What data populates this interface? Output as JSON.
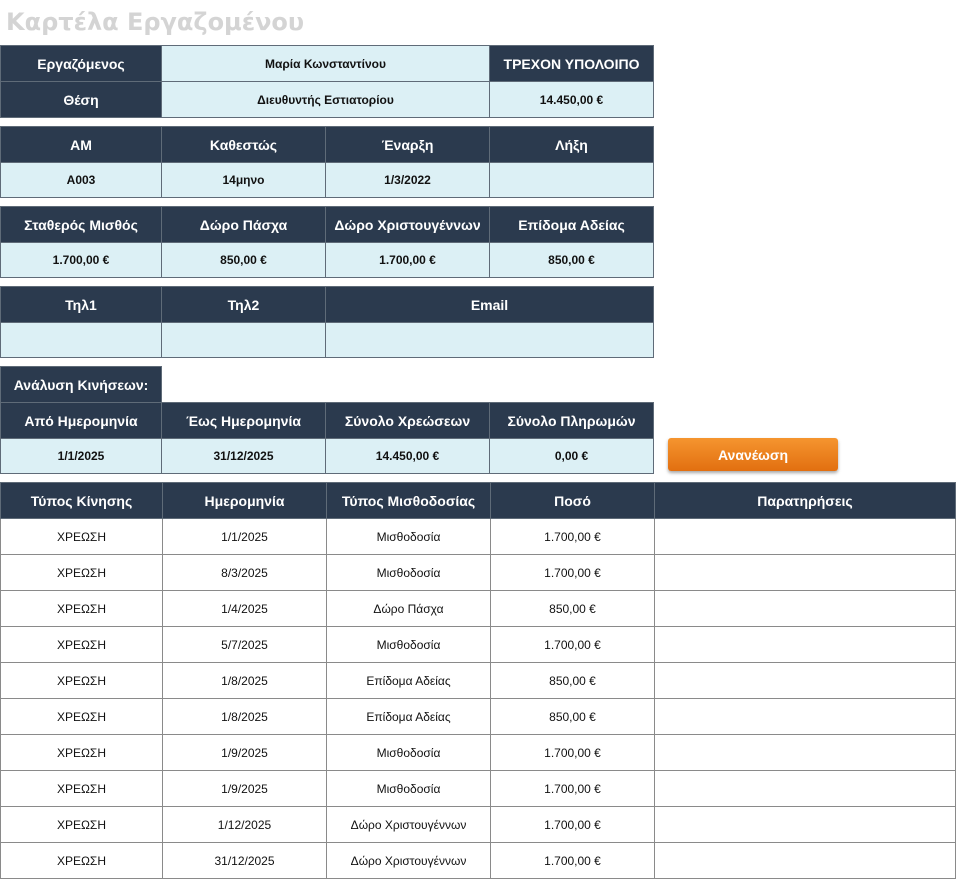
{
  "title": "Καρτέλα Εργαζομένου",
  "employee": {
    "label": "Εργαζόμενος",
    "name": "Μαρία Κωνσταντίνου",
    "position_label": "Θέση",
    "position": "Διευθυντής Εστιατορίου",
    "balance_label": "ΤΡΕΧΟΝ ΥΠΟΛΟΙΠΟ",
    "balance": "14.450,00 €"
  },
  "info": {
    "headers": [
      "ΑΜ",
      "Καθεστώς",
      "Έναρξη",
      "Λήξη"
    ],
    "values": [
      "Α003",
      "14μηνο",
      "1/3/2022",
      ""
    ]
  },
  "pay": {
    "headers": [
      "Σταθερός Μισθός",
      "Δώρο Πάσχα",
      "Δώρο Χριστουγέννων",
      "Επίδομα Αδείας"
    ],
    "values": [
      "1.700,00 €",
      "850,00 €",
      "1.700,00 €",
      "850,00 €"
    ]
  },
  "contact": {
    "headers": [
      "Τηλ1",
      "Τηλ2",
      "Email"
    ],
    "values": [
      "",
      "",
      ""
    ]
  },
  "analysis": {
    "label": "Ανάλυση Κινήσεων:",
    "headers": [
      "Από Ημερομηνία",
      "Έως Ημερομηνία",
      "Σύνολο Χρεώσεων",
      "Σύνολο Πληρωμών"
    ],
    "values": [
      "1/1/2025",
      "31/12/2025",
      "14.450,00 €",
      "0,00 €"
    ]
  },
  "refresh_button": "Ανανέωση",
  "movements": {
    "headers": [
      "Τύπος Κίνησης",
      "Ημερομηνία",
      "Τύπος Μισθοδοσίας",
      "Ποσό",
      "Παρατηρήσεις"
    ],
    "rows": [
      [
        "ΧΡΕΩΣΗ",
        "1/1/2025",
        "Μισθοδοσία",
        "1.700,00 €",
        ""
      ],
      [
        "ΧΡΕΩΣΗ",
        "8/3/2025",
        "Μισθοδοσία",
        "1.700,00 €",
        ""
      ],
      [
        "ΧΡΕΩΣΗ",
        "1/4/2025",
        "Δώρο Πάσχα",
        "850,00 €",
        ""
      ],
      [
        "ΧΡΕΩΣΗ",
        "5/7/2025",
        "Μισθοδοσία",
        "1.700,00 €",
        ""
      ],
      [
        "ΧΡΕΩΣΗ",
        "1/8/2025",
        "Επίδομα Αδείας",
        "850,00 €",
        ""
      ],
      [
        "ΧΡΕΩΣΗ",
        "1/8/2025",
        "Επίδομα Αδείας",
        "850,00 €",
        ""
      ],
      [
        "ΧΡΕΩΣΗ",
        "1/9/2025",
        "Μισθοδοσία",
        "1.700,00 €",
        ""
      ],
      [
        "ΧΡΕΩΣΗ",
        "1/9/2025",
        "Μισθοδοσία",
        "1.700,00 €",
        ""
      ],
      [
        "ΧΡΕΩΣΗ",
        "1/12/2025",
        "Δώρο Χριστουγέννων",
        "1.700,00 €",
        ""
      ],
      [
        "ΧΡΕΩΣΗ",
        "31/12/2025",
        "Δώρο Χριστουγέννων",
        "1.700,00 €",
        ""
      ]
    ]
  },
  "colors": {
    "header_bg": "#2b3a4e",
    "value_bg": "#dcf0f5",
    "button": "#f08020",
    "title": "#d4d4d4"
  }
}
